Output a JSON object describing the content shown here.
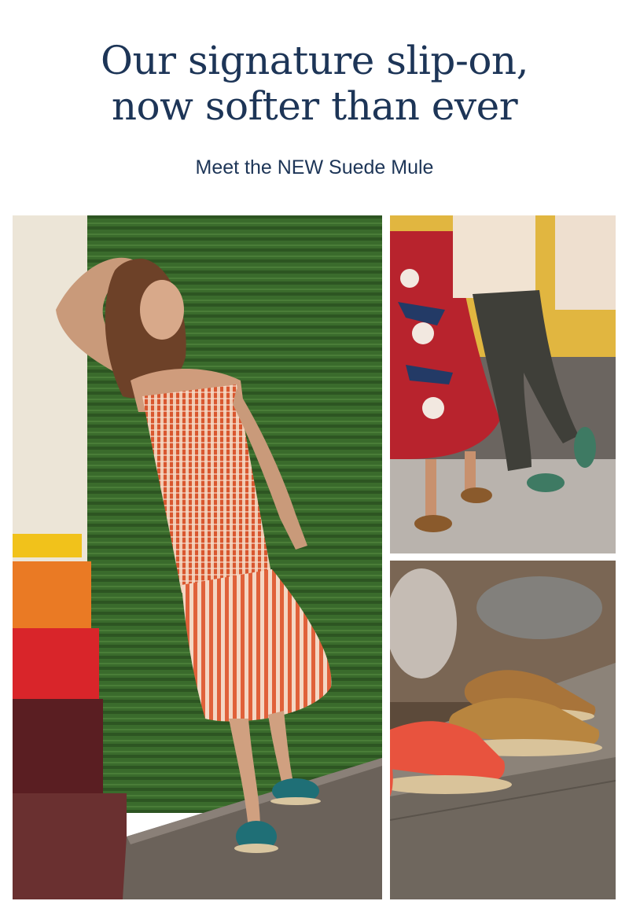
{
  "headline": {
    "line1": "Our signature slip-on,",
    "line2": "now softer than ever"
  },
  "subhead": "Meet the NEW Suede Mule",
  "colors": {
    "text": "#1d3557",
    "background": "#ffffff",
    "green_shutter": "#3a6b2c",
    "dress_orange": "#e0613a",
    "espadrille_teal": "#1f6f76",
    "red_dress": "#b8232d",
    "suede_tan": "#a8743a",
    "coral_mule": "#e8533e"
  }
}
